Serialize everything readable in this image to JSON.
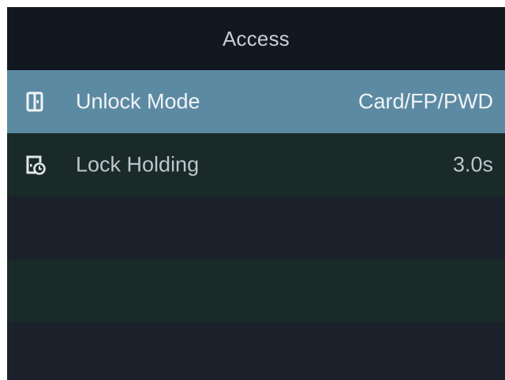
{
  "header": {
    "title": "Access"
  },
  "menu": {
    "items": [
      {
        "label": "Unlock Mode",
        "value": "Card/FP/PWD",
        "icon": "door-icon",
        "selected": true
      },
      {
        "label": "Lock Holding",
        "value": "3.0s",
        "icon": "door-timer-icon",
        "selected": false
      }
    ]
  },
  "colors": {
    "header_bg": "#111820",
    "selected_bg": "#5c8aa3",
    "row_alt_bg": "#192a29",
    "row_bg": "#1b212a"
  }
}
